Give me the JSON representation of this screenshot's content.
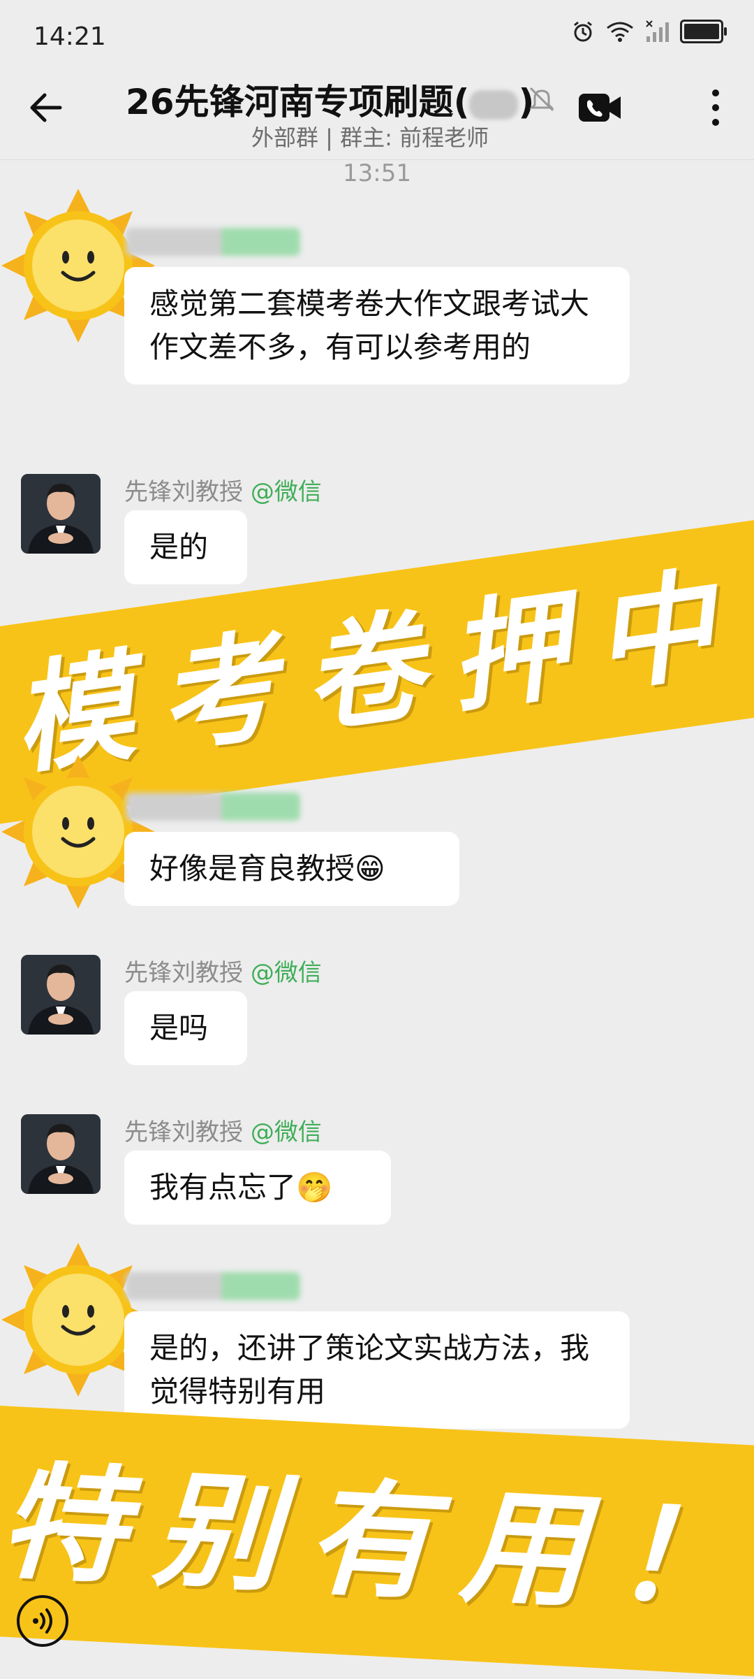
{
  "status_bar": {
    "time": "14:21",
    "icons": [
      "alarm-icon",
      "wifi-icon",
      "signal-icon",
      "battery-icon"
    ]
  },
  "header": {
    "title": "26先锋河南专项刷题(",
    "title_end": ")",
    "subtitle": "外部群 | 群主: 前程老师",
    "icons": [
      "back-arrow-icon",
      "mute-icon",
      "video-call-icon",
      "more-icon"
    ]
  },
  "timestamp": "13:51",
  "messages": [
    {
      "sender": "",
      "avatar": "sun-smiley",
      "text": "感觉第二套模考卷大作文跟考试大作文差不多，有可以参考用的"
    },
    {
      "sender": "先锋刘教授",
      "tag": "@微信",
      "avatar": "professor-photo",
      "text": "是的"
    },
    {
      "sender": "",
      "avatar": "sun-smiley",
      "text": "好像是育良教授😁"
    },
    {
      "sender": "先锋刘教授",
      "tag": "@微信",
      "avatar": "professor-photo",
      "text": "是吗"
    },
    {
      "sender": "先锋刘教授",
      "tag": "@微信",
      "avatar": "professor-photo",
      "text": "我有点忘了🤭"
    },
    {
      "sender": "",
      "avatar": "sun-smiley",
      "text": "是的，还讲了策论文实战方法，我觉得特别有用"
    }
  ],
  "banners": [
    {
      "text": "模考卷押中"
    },
    {
      "text": "特别有用！"
    }
  ],
  "colors": {
    "background": "#ededed",
    "bubble": "#ffffff",
    "banner": "#f8c318",
    "tag_green": "#3fae58"
  }
}
